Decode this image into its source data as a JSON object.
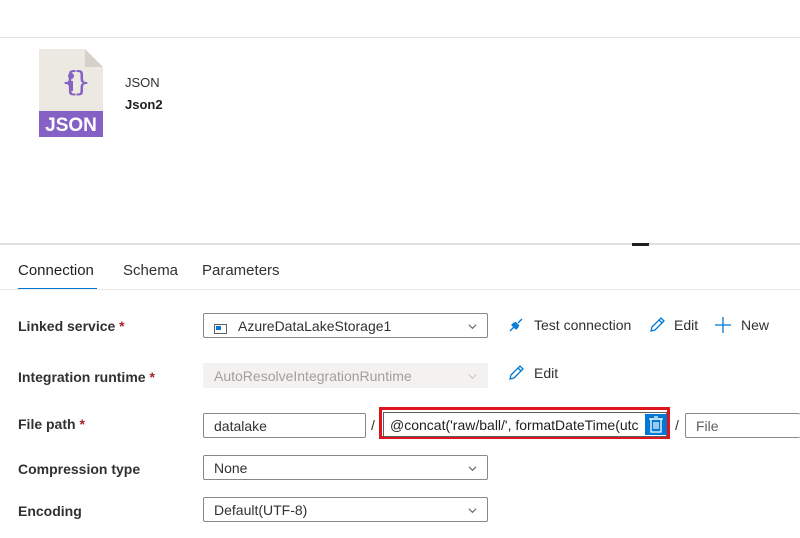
{
  "dataset": {
    "icon_label": "JSON",
    "type": "JSON",
    "name": "Json2"
  },
  "tabs": [
    {
      "label": "Connection",
      "active": true
    },
    {
      "label": "Schema",
      "active": false
    },
    {
      "label": "Parameters",
      "active": false
    }
  ],
  "form": {
    "linked_service": {
      "label": "Linked service",
      "required": "*",
      "value": "AzureDataLakeStorage1",
      "actions": {
        "test": "Test connection",
        "edit": "Edit",
        "new": "New"
      }
    },
    "integration_runtime": {
      "label": "Integration runtime",
      "required": "*",
      "value": "AutoResolveIntegrationRuntime",
      "edit": "Edit"
    },
    "file_path": {
      "label": "File path",
      "required": "*",
      "container": "datalake",
      "separator": "/",
      "directory_expression": "@concat('raw/ball/', formatDateTime(utc",
      "file_placeholder": "File"
    },
    "compression_type": {
      "label": "Compression type",
      "value": "None"
    },
    "encoding": {
      "label": "Encoding",
      "value": "Default(UTF-8)"
    }
  },
  "colors": {
    "accent": "#0078d4",
    "highlight_border": "#e0141e",
    "json_icon_band": "#8661c5",
    "json_icon_body": "#ece9e3"
  }
}
